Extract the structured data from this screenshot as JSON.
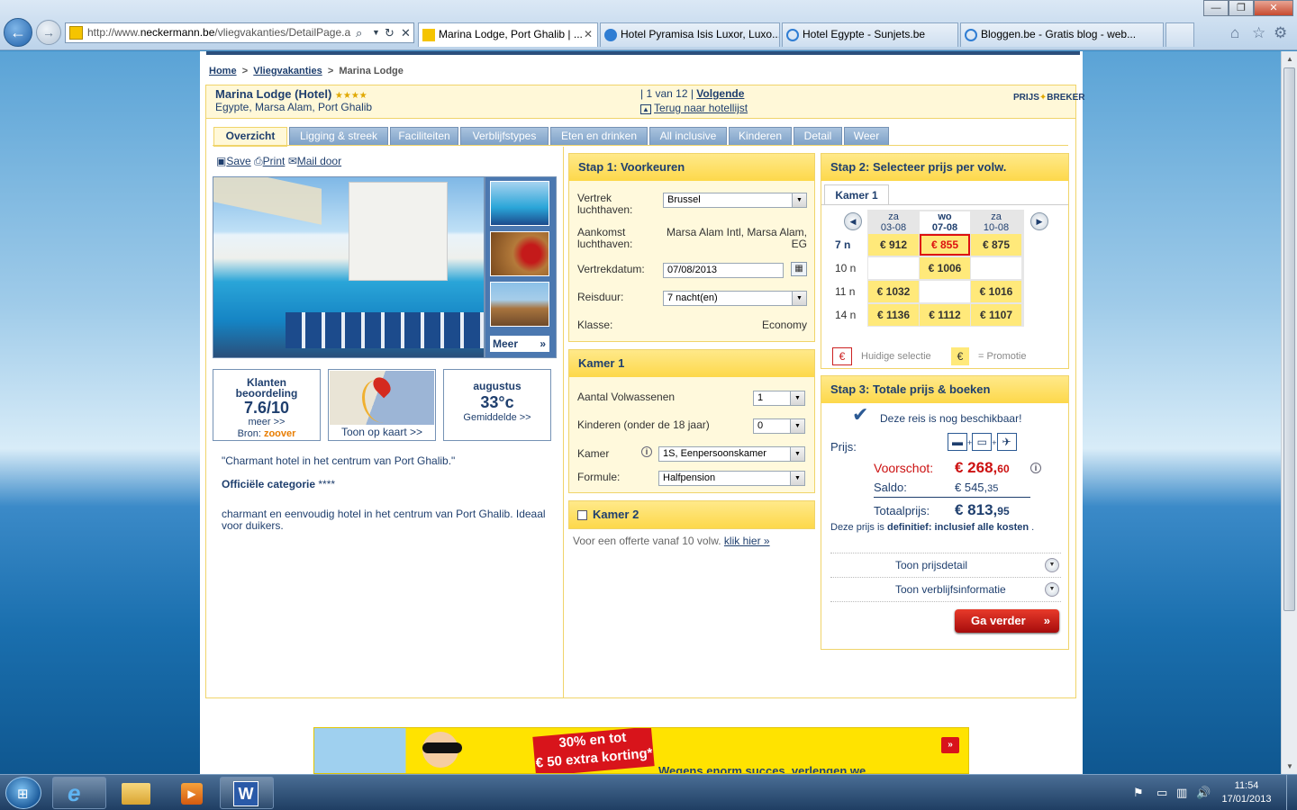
{
  "browser": {
    "url_host": "http://www.",
    "url_domain": "neckermann.be",
    "url_path": "/vliegvakanties/DetailPage.a",
    "tabs": [
      {
        "label": "Marina Lodge, Port Ghalib | ...",
        "active": true
      },
      {
        "label": "Hotel Pyramisa Isis Luxor, Luxo...",
        "active": false
      },
      {
        "label": "Hotel Egypte - Sunjets.be",
        "active": false
      },
      {
        "label": "Bloggen.be - Gratis blog - web...",
        "active": false
      }
    ]
  },
  "breadcrumb": {
    "home": "Home",
    "sep1": ">",
    "section": "Vliegvakanties",
    "sep2": ">",
    "current": "Marina Lodge"
  },
  "hotel": {
    "name": "Marina Lodge (Hotel)",
    "stars": "★★★★",
    "location": "Egypte, Marsa Alam, Port Ghalib",
    "pager_prefix": "| 1 van 12 |",
    "next": "Volgende",
    "back_icon": "▲",
    "back": "Terug naar hotellijst",
    "logo": "PRIJS",
    "logo2": "BREKER"
  },
  "tabs": [
    "Overzicht",
    "Ligging & streek",
    "Faciliteiten",
    "Verblijfstypes",
    "Eten en drinken",
    "All inclusive",
    "Kinderen",
    "Detail",
    "Weer"
  ],
  "actions": {
    "save": "Save",
    "print": "Print",
    "mail": "Mail door"
  },
  "gallery": {
    "more": "Meer",
    "more_arrow": "»"
  },
  "rating": {
    "title": "Klanten beoordeling",
    "score": "7.6/10",
    "more": "meer >>",
    "source_label": "Bron:",
    "source": "zoover"
  },
  "map": {
    "link": "Toon op kaart >>"
  },
  "weather": {
    "month": "augustus",
    "temp": "33°c",
    "avg": "Gemiddelde >>"
  },
  "description": {
    "quote": "\"Charmant hotel in het centrum van Port Ghalib.\"",
    "cat_label": "Officiële categorie",
    "cat_stars": "****",
    "text": "charmant en eenvoudig hotel in het centrum van Port Ghalib. Ideaal voor duikers."
  },
  "step1": {
    "title": "Stap 1: Voorkeuren",
    "departure_label": "Vertrek luchthaven:",
    "departure": "Brussel",
    "arrival_label": "Aankomst luchthaven:",
    "arrival": "Marsa Alam Intl, Marsa Alam, EG",
    "date_label": "Vertrekdatum:",
    "date": "07/08/2013",
    "duration_label": "Reisduur:",
    "duration": "7 nacht(en)",
    "class_label": "Klasse:",
    "class": "Economy"
  },
  "room1": {
    "title": "Kamer 1",
    "adults_label": "Aantal Volwassenen",
    "adults": "1",
    "children_label": "Kinderen (onder de 18 jaar)",
    "children": "0",
    "room_label": "Kamer",
    "room": "1S, Eenpersoonskamer",
    "board_label": "Formule:",
    "board": "Halfpension"
  },
  "room2": {
    "title": "Kamer 2",
    "note": "Voor een offerte vanaf 10 volw.",
    "link": "klik hier »"
  },
  "step2": {
    "title": "Stap 2: Selecteer prijs per volw.",
    "room_tab": "Kamer 1",
    "days": [
      {
        "dow": "za",
        "date": "03-08"
      },
      {
        "dow": "wo",
        "date": "07-08"
      },
      {
        "dow": "za",
        "date": "10-08"
      }
    ],
    "rows": [
      {
        "label": "7 n",
        "prices": [
          "€ 912",
          "€ 855",
          "€ 875"
        ]
      },
      {
        "label": "10 n",
        "prices": [
          "",
          "€ 1006",
          ""
        ]
      },
      {
        "label": "11 n",
        "prices": [
          "€ 1032",
          "",
          "€ 1016"
        ]
      },
      {
        "label": "14 n",
        "prices": [
          "€ 1136",
          "€ 1112",
          "€ 1107"
        ]
      }
    ],
    "legend_current_symbol": "€",
    "legend_current": "Huidige selectie",
    "legend_promo_symbol": "€",
    "legend_promo": "= Promotie"
  },
  "step3": {
    "title": "Stap 3: Totale prijs & boeken",
    "available": "Deze reis is nog beschikbaar!",
    "price_label": "Prijs:",
    "deposit_label": "Voorschot:",
    "deposit_main": "€ 268,",
    "deposit_cents": "60",
    "balance_label": "Saldo:",
    "balance_main": "€ 545,",
    "balance_cents": "35",
    "total_label": "Totaalprijs:",
    "total_main": "€ 813,",
    "total_cents": "95",
    "final_prefix": "Deze prijs is",
    "final_bold": "definitief",
    "final_colon": ":",
    "final_suffix": "inclusief alle kosten",
    "final_dot": ".",
    "price_detail": "Toon prijsdetail",
    "stay_info": "Toon verblijfsinformatie",
    "continue": "Ga verder",
    "continue_arrow": "»"
  },
  "banner": {
    "line1": "30% en tot",
    "line2": "€ 50 extra korting*",
    "line3": "Wegens enorm succes, verlengen we"
  },
  "clock": {
    "time": "11:54",
    "date": "17/01/2013"
  },
  "colors": {
    "brand_blue": "#1f3f6e",
    "accent_yellow": "#ffe97a",
    "price_red": "#cc1111",
    "tab_blue": "#7ea1c7"
  }
}
